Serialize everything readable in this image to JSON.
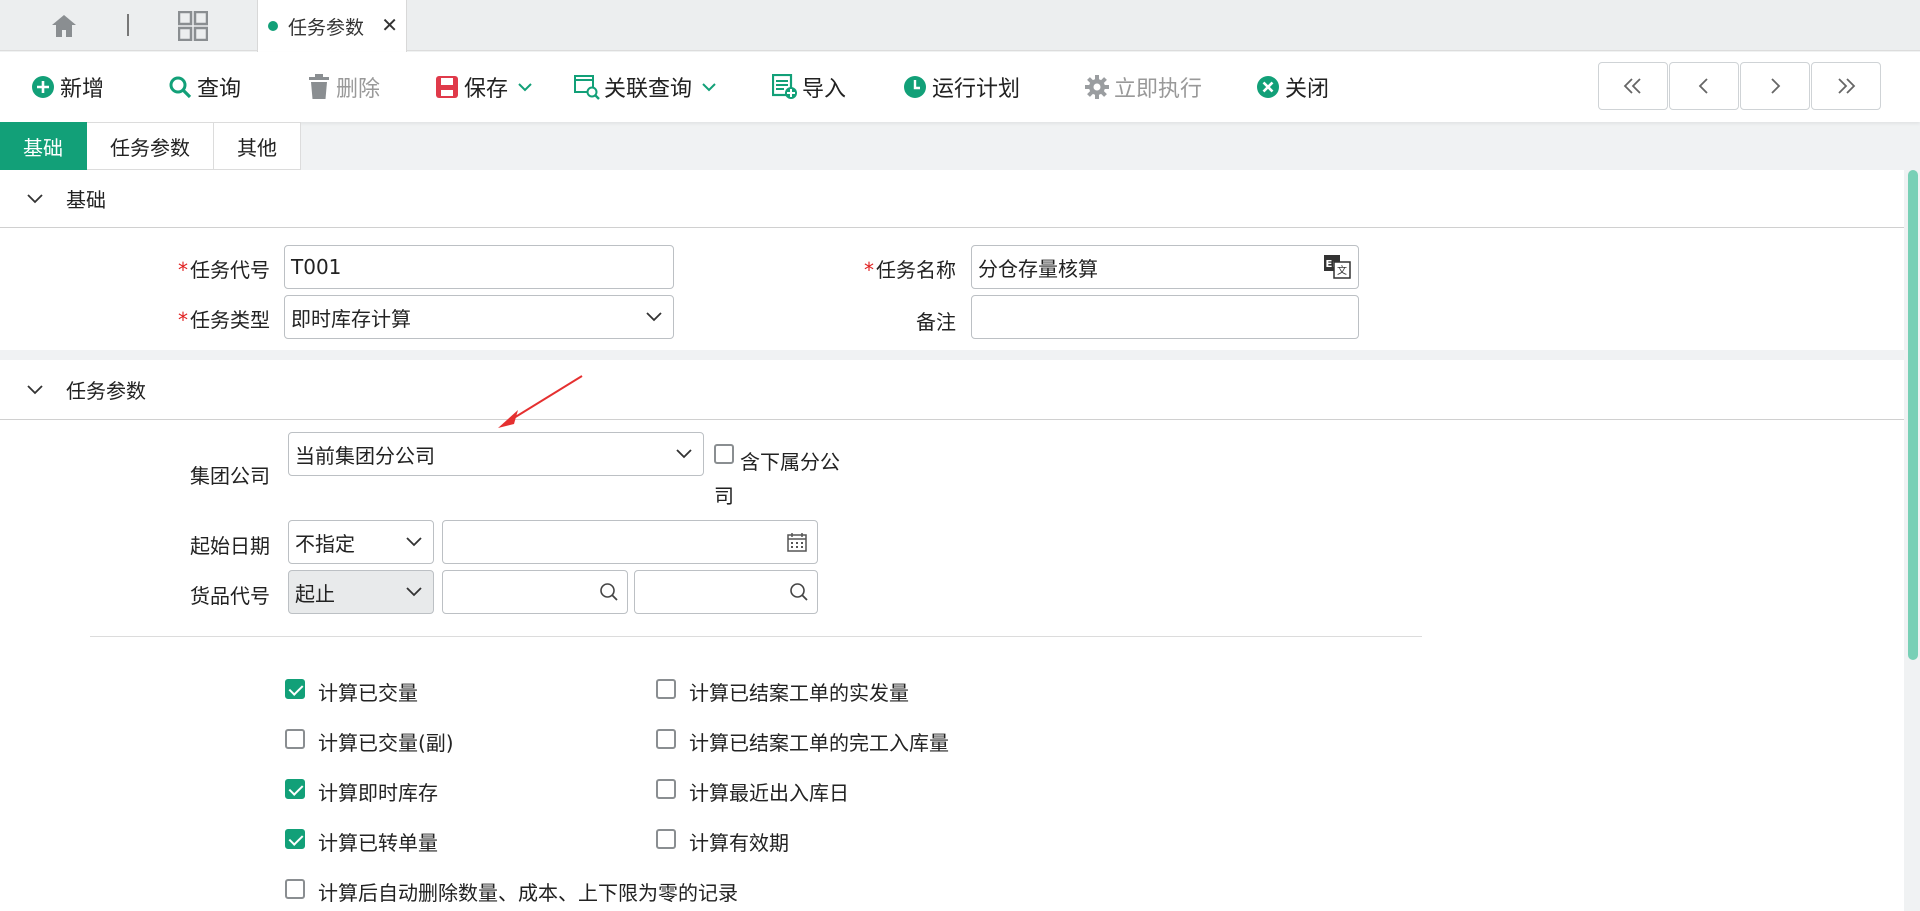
{
  "tabstrip": {
    "tab_label": "任务参数",
    "accent": "#12a078"
  },
  "toolbar": {
    "add": "新增",
    "query": "查询",
    "delete": "删除",
    "save": "保存",
    "related_query": "关联查询",
    "import": "导入",
    "run_plan": "运行计划",
    "execute_now": "立即执行",
    "close": "关闭"
  },
  "subtabs": [
    "基础",
    "任务参数",
    "其他"
  ],
  "basic": {
    "title": "基础",
    "task_code_label": "任务代号",
    "task_code_value": "T001",
    "task_name_label": "任务名称",
    "task_name_value": "分仓存量核算",
    "task_type_label": "任务类型",
    "task_type_value": "即时库存计算",
    "remark_label": "备注",
    "remark_value": ""
  },
  "params": {
    "title": "任务参数",
    "group_company_label": "集团公司",
    "group_company_value": "当前集团分公司",
    "include_sub_label_1": "含下属分公",
    "include_sub_label_2": "司",
    "start_date_label": "起始日期",
    "start_date_mode": "不指定",
    "start_date_value": "",
    "item_code_label": "货品代号",
    "item_code_mode": "起止",
    "item_code_from": "",
    "item_code_to": "",
    "options_left": [
      {
        "label": "计算已交量",
        "checked": true
      },
      {
        "label": "计算已交量(副)",
        "checked": false
      },
      {
        "label": "计算即时库存",
        "checked": true
      },
      {
        "label": "计算已转单量",
        "checked": true
      },
      {
        "label": "计算后自动删除数量、成本、上下限为零的记录",
        "checked": false
      }
    ],
    "options_right": [
      {
        "label": "计算已结案工单的实发量",
        "checked": false
      },
      {
        "label": "计算已结案工单的完工入库量",
        "checked": false
      },
      {
        "label": "计算最近出入库日",
        "checked": false
      },
      {
        "label": "计算有效期",
        "checked": false
      }
    ]
  }
}
